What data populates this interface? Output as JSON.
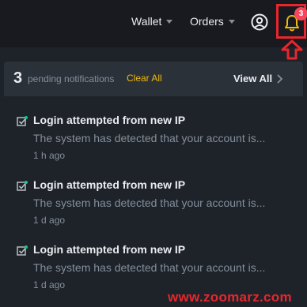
{
  "topbar": {
    "wallet_label": "Wallet",
    "orders_label": "Orders",
    "notification_badge": "3"
  },
  "panel": {
    "count": "3",
    "pending_label": "pending notifications",
    "clear_all_label": "Clear All",
    "view_all_label": "View All"
  },
  "notifications": [
    {
      "title": "Login attempted from new IP",
      "description": "The system has detected that your account is...",
      "time": "1 h ago"
    },
    {
      "title": "Login attempted from new IP",
      "description": "The system has detected that your account is...",
      "time": "1 d ago"
    },
    {
      "title": "Login attempted from new IP",
      "description": "The system has detected that your account is...",
      "time": "1 d ago"
    }
  ],
  "watermark": "www.zoomarz.com",
  "colors": {
    "accent": "#f0b90b",
    "highlight": "#e8262c",
    "success": "#0ecb81"
  }
}
